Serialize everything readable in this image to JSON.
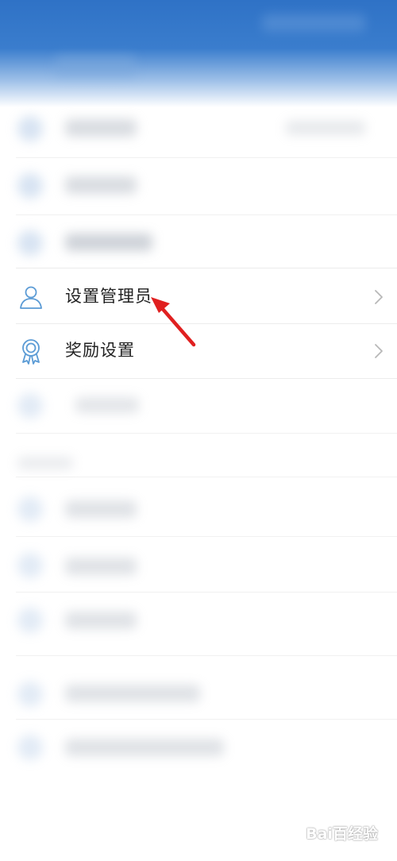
{
  "settings_list": {
    "items": [
      {
        "label": "设置管理员",
        "icon": "person-icon"
      },
      {
        "label": "奖励设置",
        "icon": "award-ribbon-icon"
      }
    ]
  },
  "annotation": {
    "icon": "red-arrow-pointer",
    "color": "#e02020"
  },
  "watermark": {
    "text": "Bai百经验",
    "icon": "paw-logo"
  },
  "colors": {
    "header": "#3a7dcd",
    "icon_stroke": "#5b9bd5",
    "text": "#222222",
    "chevron": "#b8b8b8"
  }
}
